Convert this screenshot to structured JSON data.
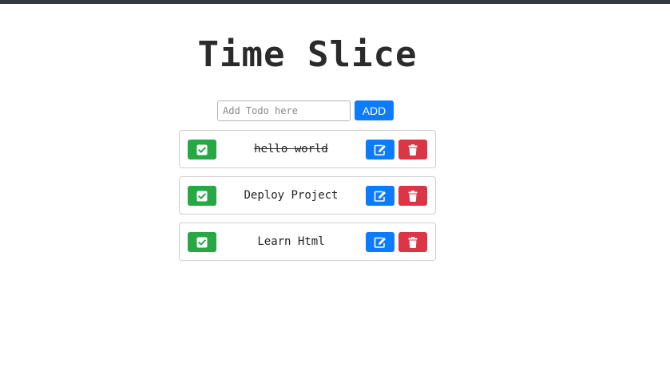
{
  "app": {
    "title": "Time Slice"
  },
  "add_form": {
    "placeholder": "Add Todo here",
    "value": "",
    "button_label": "ADD"
  },
  "todos": [
    {
      "text": "hello world",
      "completed": true
    },
    {
      "text": "Deploy Project",
      "completed": false
    },
    {
      "text": "Learn Html",
      "completed": false
    }
  ],
  "icons": {
    "complete": "check-square-icon",
    "edit": "edit-icon",
    "delete": "trash-icon"
  },
  "colors": {
    "top_bar": "#343a40",
    "primary": "#0d7bfd",
    "success": "#28a745",
    "danger": "#dc3545"
  }
}
